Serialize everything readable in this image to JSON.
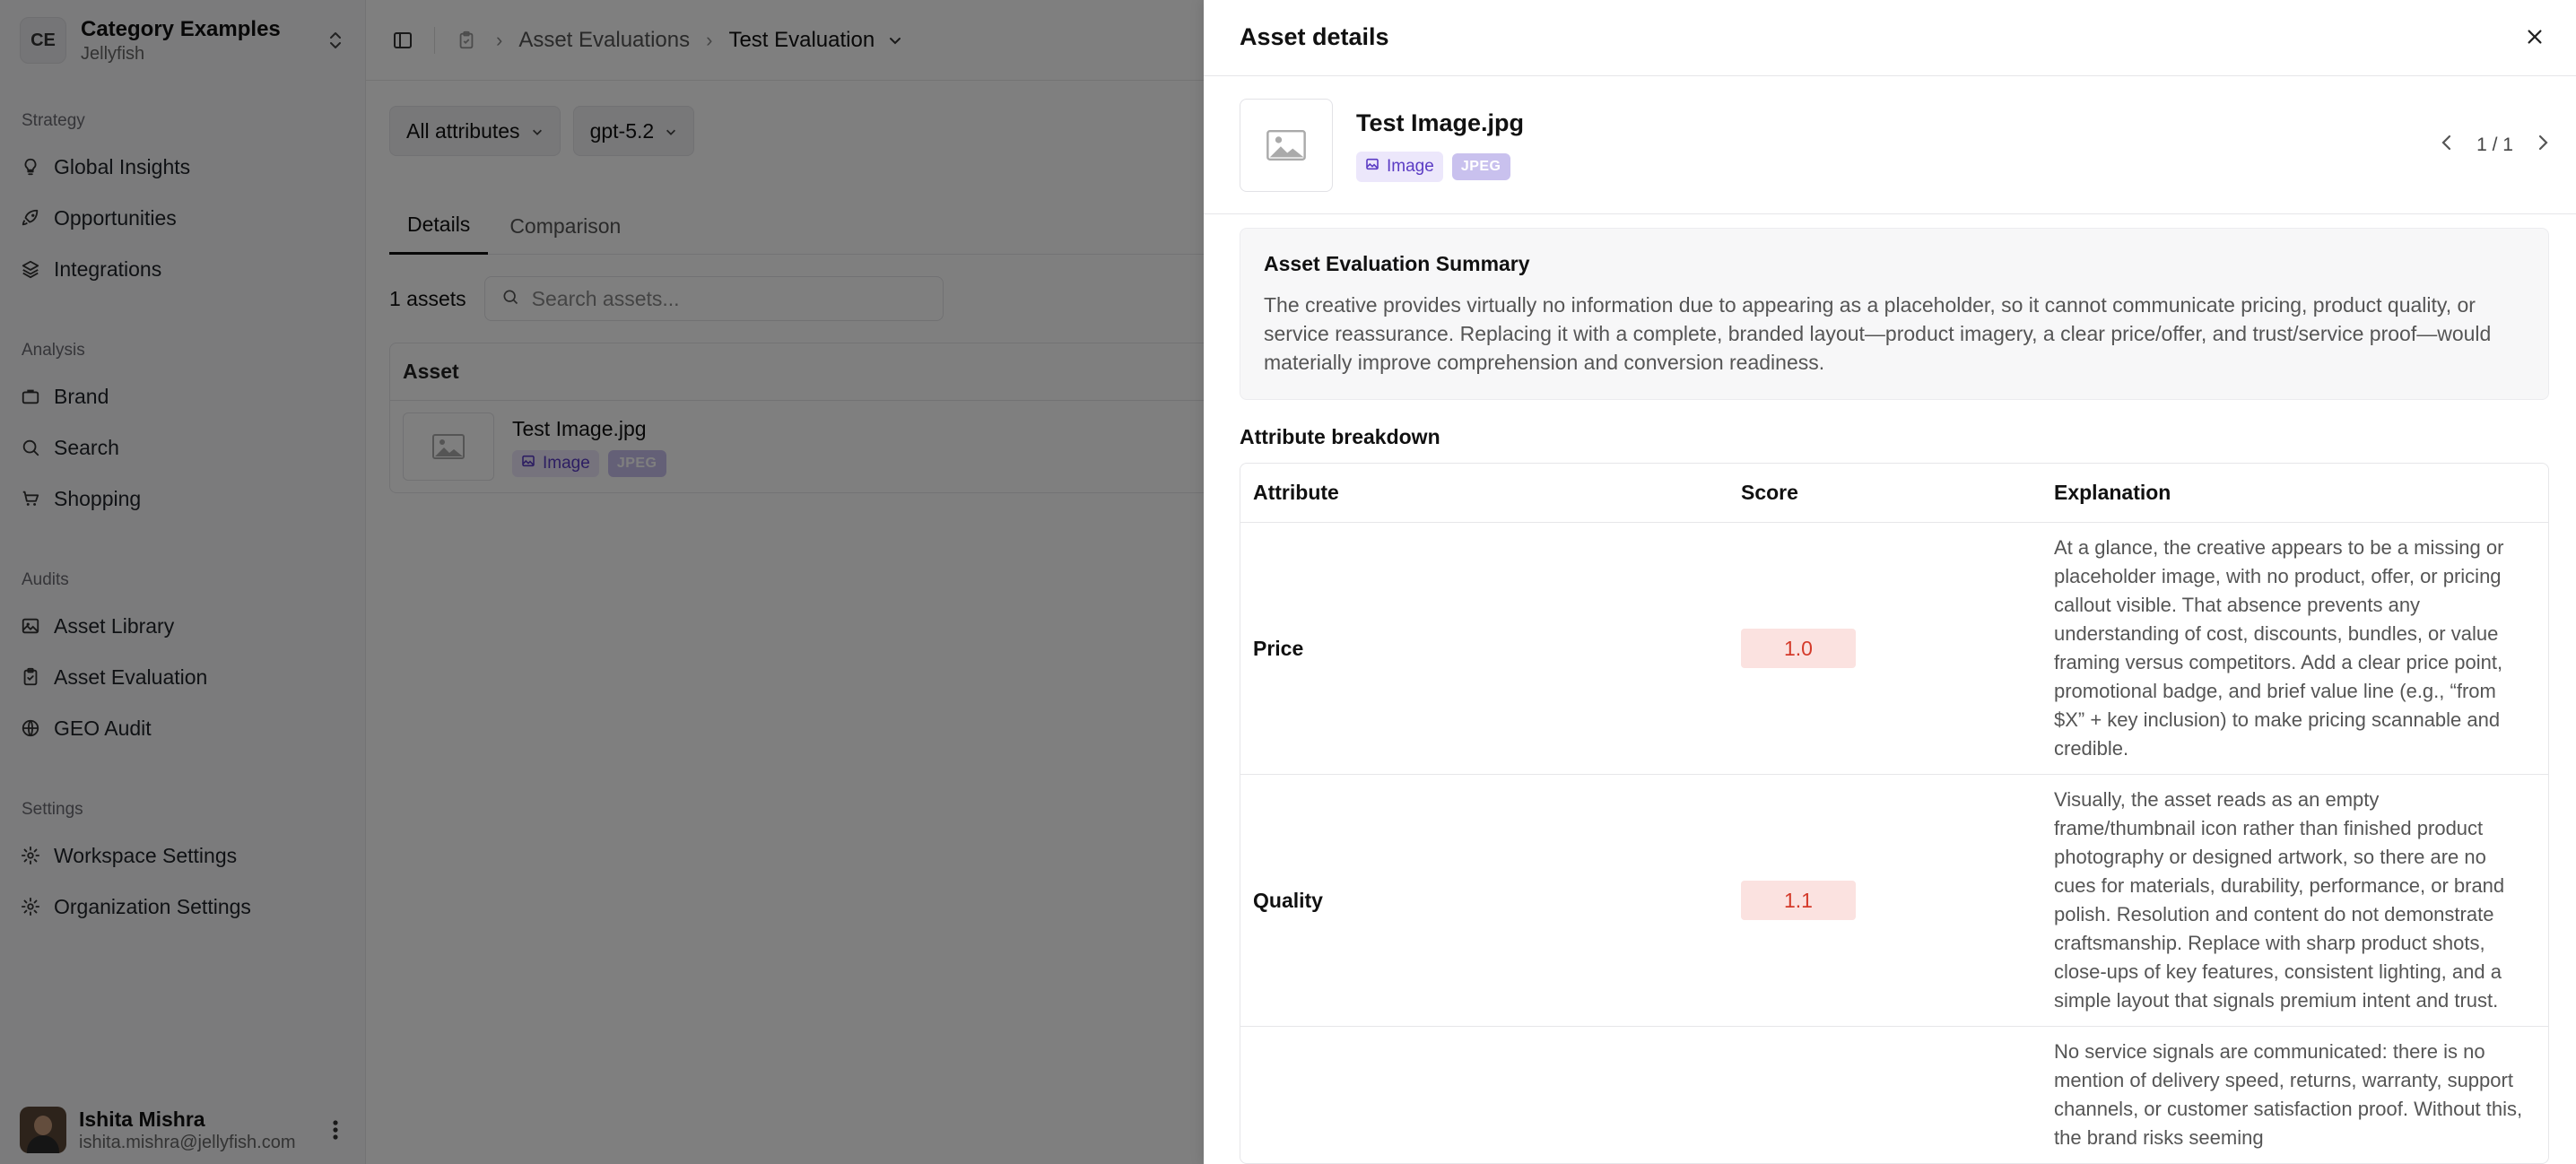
{
  "workspace": {
    "initials": "CE",
    "name": "Category Examples",
    "org": "Jellyfish"
  },
  "sidebar": {
    "sections": [
      {
        "label": "Strategy",
        "items": [
          {
            "label": "Global Insights",
            "icon": "lightbulb-icon"
          },
          {
            "label": "Opportunities",
            "icon": "rocket-icon"
          },
          {
            "label": "Integrations",
            "icon": "layers-icon"
          }
        ]
      },
      {
        "label": "Analysis",
        "items": [
          {
            "label": "Brand",
            "icon": "briefcase-icon"
          },
          {
            "label": "Search",
            "icon": "search-icon"
          },
          {
            "label": "Shopping",
            "icon": "cart-icon"
          }
        ]
      },
      {
        "label": "Audits",
        "items": [
          {
            "label": "Asset Library",
            "icon": "image-icon"
          },
          {
            "label": "Asset Evaluation",
            "icon": "clipboard-check-icon"
          },
          {
            "label": "GEO Audit",
            "icon": "globe-icon"
          }
        ]
      },
      {
        "label": "Settings",
        "items": [
          {
            "label": "Workspace Settings",
            "icon": "gear-icon"
          },
          {
            "label": "Organization Settings",
            "icon": "gear-icon"
          }
        ]
      }
    ]
  },
  "user": {
    "name": "Ishita Mishra",
    "email": "ishita.mishra@jellyfish.com"
  },
  "breadcrumb": {
    "parent": "Asset Evaluations",
    "current": "Test Evaluation"
  },
  "filters": {
    "attributes": "All attributes",
    "model": "gpt-5.2"
  },
  "tabs": {
    "details": "Details",
    "comparison": "Comparison"
  },
  "assets": {
    "count_label": "1 assets",
    "search_placeholder": "Search assets...",
    "column_header": "Asset",
    "rows": [
      {
        "name": "Test Image.jpg",
        "type": "Image",
        "format": "JPEG"
      }
    ]
  },
  "drawer": {
    "title": "Asset details",
    "asset_name": "Test Image.jpg",
    "asset_type": "Image",
    "asset_format": "JPEG",
    "pager": "1 / 1",
    "summary_title": "Asset Evaluation Summary",
    "summary_text": "The creative provides virtually no information due to appearing as a placeholder, so it cannot communicate pricing, product quality, or service reassurance. Replacing it with a complete, branded layout—product imagery, a clear price/offer, and trust/service proof—would materially improve comprehension and conversion readiness.",
    "breakdown_title": "Attribute breakdown",
    "breakdown_headers": {
      "attribute": "Attribute",
      "score": "Score",
      "explanation": "Explanation"
    },
    "breakdown_rows": [
      {
        "attribute": "Price",
        "score": "1.0",
        "explanation": "At a glance, the creative appears to be a missing or placeholder image, with no product, offer, or pricing callout visible. That absence prevents any understanding of cost, discounts, bundles, or value framing versus competitors. Add a clear price point, promotional badge, and brief value line (e.g., “from $X” + key inclusion) to make pricing scannable and credible."
      },
      {
        "attribute": "Quality",
        "score": "1.1",
        "explanation": "Visually, the asset reads as an empty frame/thumbnail icon rather than finished product photography or designed artwork, so there are no cues for materials, durability, performance, or brand polish. Resolution and content do not demonstrate craftsmanship. Replace with sharp product shots, close-ups of key features, consistent lighting, and a simple layout that signals premium intent and trust."
      },
      {
        "attribute": "",
        "score": "",
        "explanation": "No service signals are communicated: there is no mention of delivery speed, returns, warranty, support channels, or customer satisfaction proof. Without this, the brand risks seeming"
      }
    ]
  },
  "colors": {
    "score_bg": "#fbe2e0",
    "score_text": "#d43a2a",
    "tag_image_bg": "#ece7fb",
    "tag_jpeg_bg": "#c9c1ee"
  }
}
